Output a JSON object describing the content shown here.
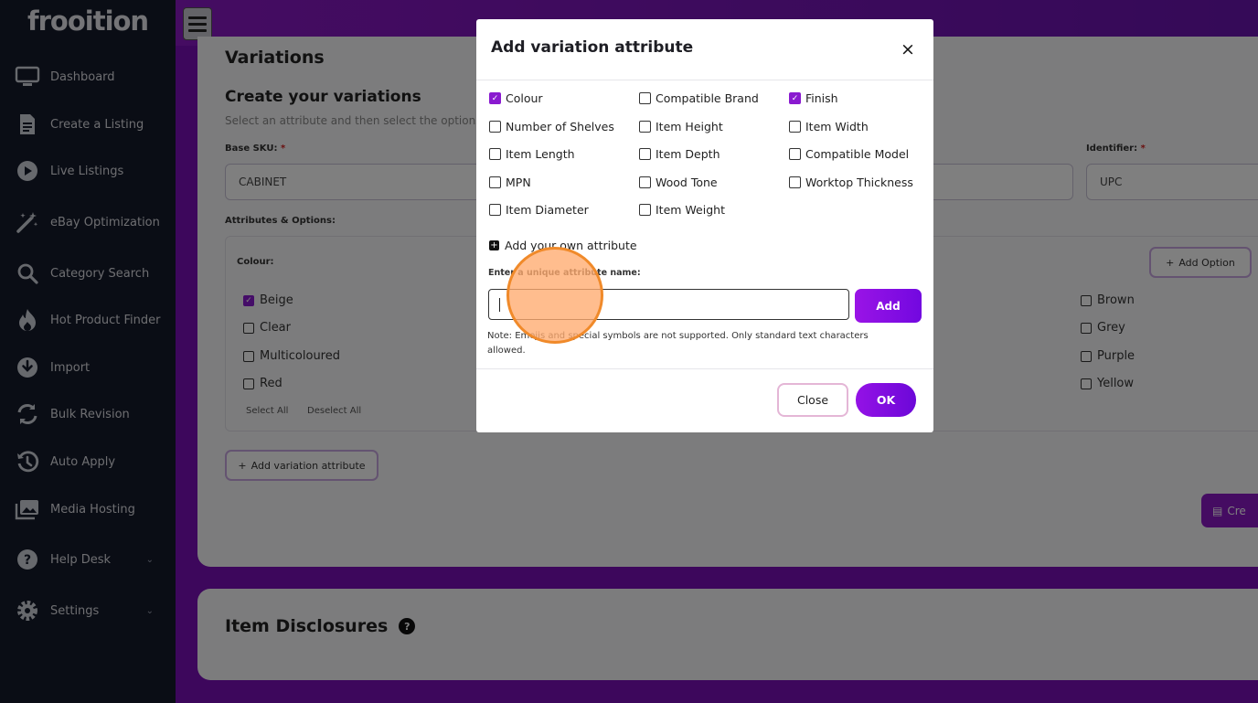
{
  "app": {
    "logo": "frooition"
  },
  "sidebar": {
    "items": [
      {
        "label": "Dashboard",
        "icon": "monitor-icon"
      },
      {
        "label": "Create a Listing",
        "icon": "document-icon"
      },
      {
        "label": "Live Listings",
        "icon": "play-icon"
      },
      {
        "label": "eBay Optimization",
        "icon": "magic-wand-icon"
      },
      {
        "label": "Category Search",
        "icon": "search-icon"
      },
      {
        "label": "Hot Product Finder",
        "icon": "flame-icon"
      },
      {
        "label": "Import",
        "icon": "download-icon"
      },
      {
        "label": "Bulk Revision",
        "icon": "sync-icon"
      },
      {
        "label": "Auto Apply",
        "icon": "history-icon"
      },
      {
        "label": "Media Hosting",
        "icon": "images-icon"
      },
      {
        "label": "Help Desk",
        "icon": "help-icon"
      },
      {
        "label": "Settings",
        "icon": "gear-icon"
      }
    ]
  },
  "variations": {
    "title": "Variations",
    "create_title": "Create your variations",
    "subtext": "Select an attribute and then select the options",
    "base_sku_label": "Base SKU:",
    "base_sku_value": "CABINET",
    "identifier_label": "Identifier:",
    "identifier_value": "UPC",
    "required_mark": "*",
    "attributes_label": "Attributes & Options:",
    "colour_label": "Colour:",
    "add_option": "Add Option",
    "options_left": [
      {
        "label": "Beige",
        "checked": true
      },
      {
        "label": "Clear",
        "checked": false
      },
      {
        "label": "Multicoloured",
        "checked": false
      },
      {
        "label": "Red",
        "checked": false
      }
    ],
    "options_right": [
      {
        "label": "Brown",
        "checked": false
      },
      {
        "label": "Grey",
        "checked": false
      },
      {
        "label": "Purple",
        "checked": false
      },
      {
        "label": "Yellow",
        "checked": false
      }
    ],
    "select_all": "Select All",
    "deselect_all": "Deselect All",
    "add_variation_attribute": "Add variation attribute",
    "create_button": "Cre"
  },
  "item_disclosures": {
    "title": "Item Disclosures",
    "help": "?"
  },
  "modal": {
    "title": "Add variation attribute",
    "close_glyph": "×",
    "attributes": [
      [
        {
          "label": "Colour",
          "checked": true
        },
        {
          "label": "Compatible Brand",
          "checked": false
        },
        {
          "label": "Finish",
          "checked": true
        }
      ],
      [
        {
          "label": "Number of Shelves",
          "checked": false
        },
        {
          "label": "Item Height",
          "checked": false
        },
        {
          "label": "Item Width",
          "checked": false
        }
      ],
      [
        {
          "label": "Item Length",
          "checked": false
        },
        {
          "label": "Item Depth",
          "checked": false
        },
        {
          "label": "Compatible Model",
          "checked": false
        }
      ],
      [
        {
          "label": "MPN",
          "checked": false
        },
        {
          "label": "Wood Tone",
          "checked": false
        },
        {
          "label": "Worktop Thickness",
          "checked": false
        }
      ],
      [
        {
          "label": "Item Diameter",
          "checked": false
        },
        {
          "label": "Item Weight",
          "checked": false
        }
      ]
    ],
    "add_own": "Add your own attribute",
    "enter_label": "Enter a unique attribute name:",
    "input_value": "",
    "add_button": "Add",
    "note": "Note: Emojis and special symbols are not supported. Only standard text characters allowed.",
    "close_button": "Close",
    "ok_button": "OK"
  },
  "colors": {
    "accent": "#8a18c4",
    "sidebar_bg": "#141a2b",
    "click_marker": "#f08a2a"
  }
}
